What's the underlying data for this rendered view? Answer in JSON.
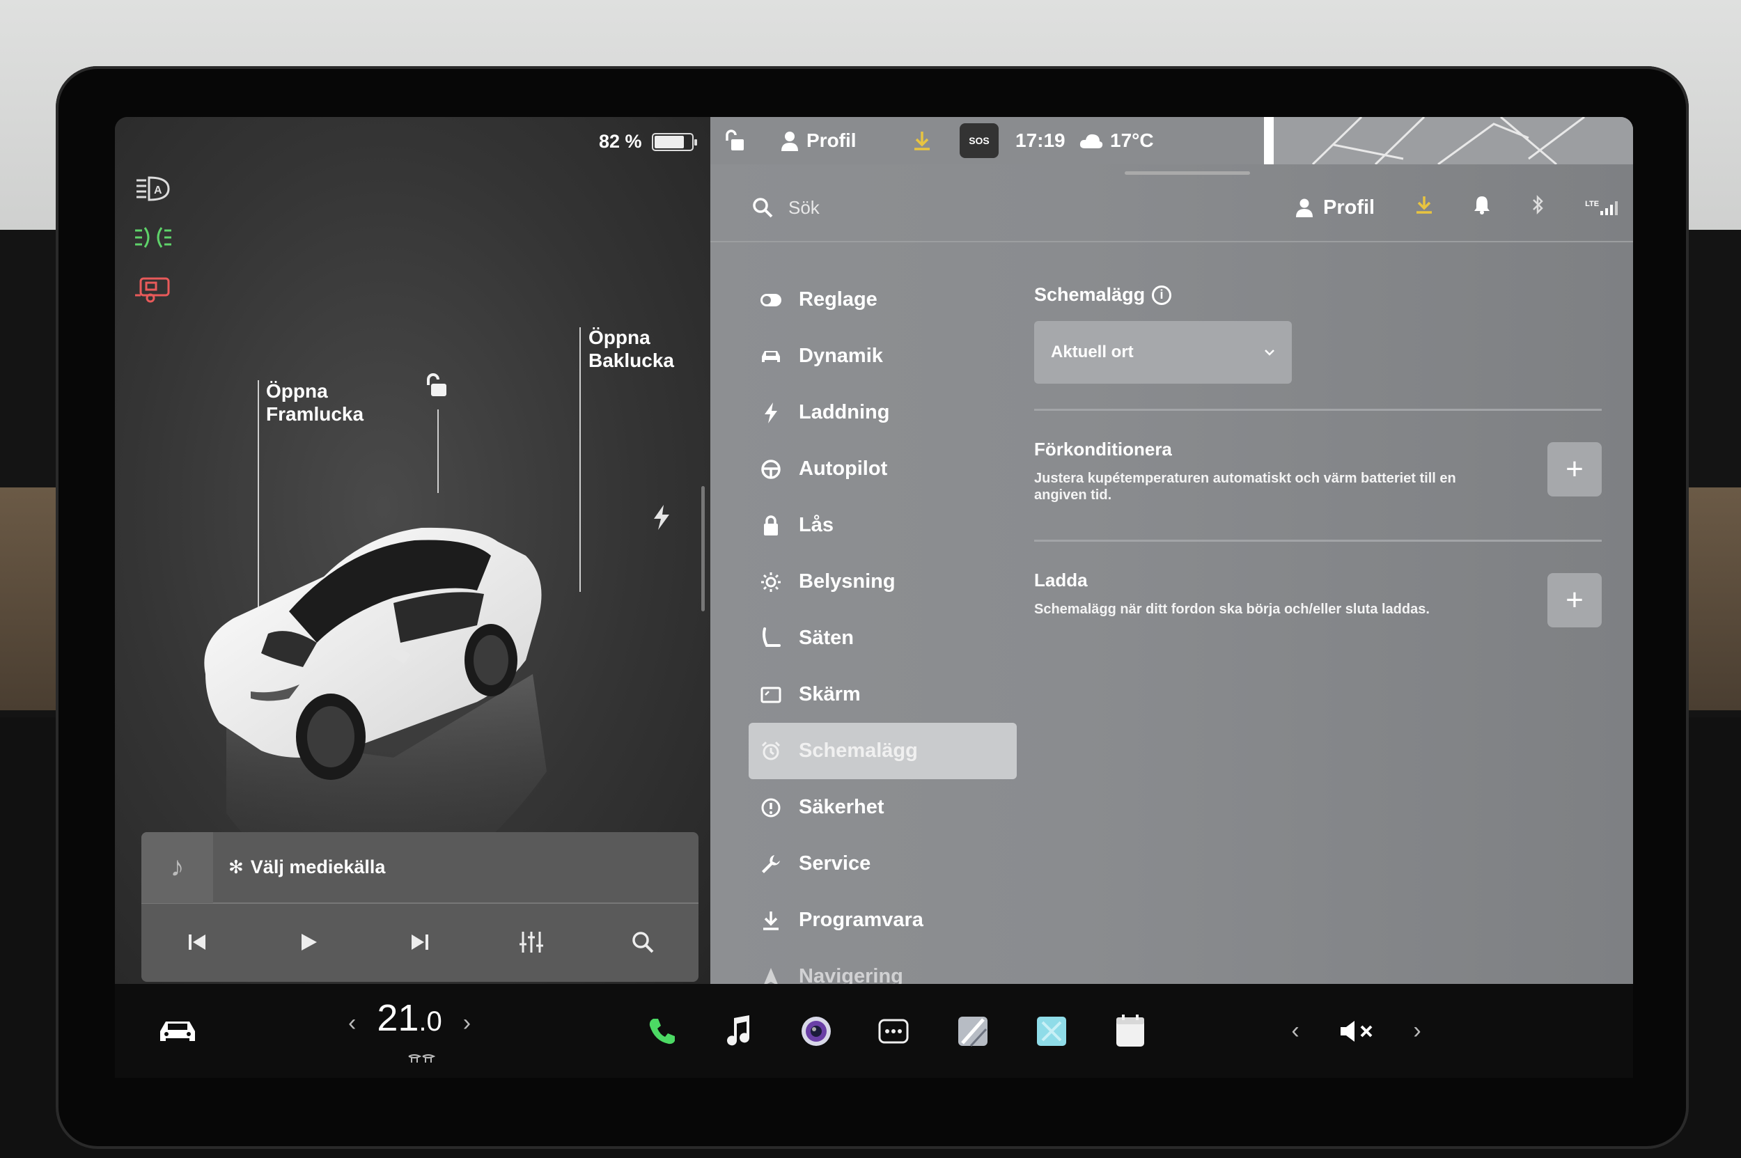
{
  "status": {
    "battery_percent": "82 %",
    "battery_level": 0.82,
    "profile": "Profil",
    "time": "17:19",
    "temperature": "17°C",
    "sos": "SOS"
  },
  "car_panel": {
    "front_trunk": [
      "Öppna",
      "Framlucka"
    ],
    "rear_trunk": [
      "Öppna",
      "Baklucka"
    ]
  },
  "media": {
    "source_label": "Välj mediekälla"
  },
  "search": {
    "placeholder": "Sök"
  },
  "top_bar": {
    "profile": "Profil",
    "lte": "LTE"
  },
  "menu": {
    "items": [
      {
        "label": "Reglage",
        "icon": "toggle-icon"
      },
      {
        "label": "Dynamik",
        "icon": "car-icon"
      },
      {
        "label": "Laddning",
        "icon": "bolt-icon"
      },
      {
        "label": "Autopilot",
        "icon": "steering-wheel-icon"
      },
      {
        "label": "Lås",
        "icon": "lock-icon"
      },
      {
        "label": "Belysning",
        "icon": "sun-icon"
      },
      {
        "label": "Säten",
        "icon": "seat-icon"
      },
      {
        "label": "Skärm",
        "icon": "display-icon"
      },
      {
        "label": "Schemalägg",
        "icon": "alarm-clock-icon"
      },
      {
        "label": "Säkerhet",
        "icon": "alert-circle-icon"
      },
      {
        "label": "Service",
        "icon": "wrench-icon"
      },
      {
        "label": "Programvara",
        "icon": "download-icon"
      },
      {
        "label": "Navigering",
        "icon": "navigation-icon"
      }
    ],
    "active": "Schemalägg"
  },
  "schedule": {
    "title": "Schemalägg",
    "dropdown_value": "Aktuell ort",
    "precondition_title": "Förkonditionera",
    "precondition_desc": "Justera kupétemperaturen automatiskt och värm batteriet till en angiven tid.",
    "charge_title": "Ladda",
    "charge_desc": "Schemalägg när ditt fordon ska börja och/eller sluta laddas."
  },
  "dock": {
    "temperature_whole": "21",
    "temperature_decimal": ".0"
  },
  "colors": {
    "accent_yellow": "#e8c440",
    "headlight_green": "#5fd36a",
    "trailer_red": "#e85a5a",
    "phone_green": "#4cd964"
  }
}
